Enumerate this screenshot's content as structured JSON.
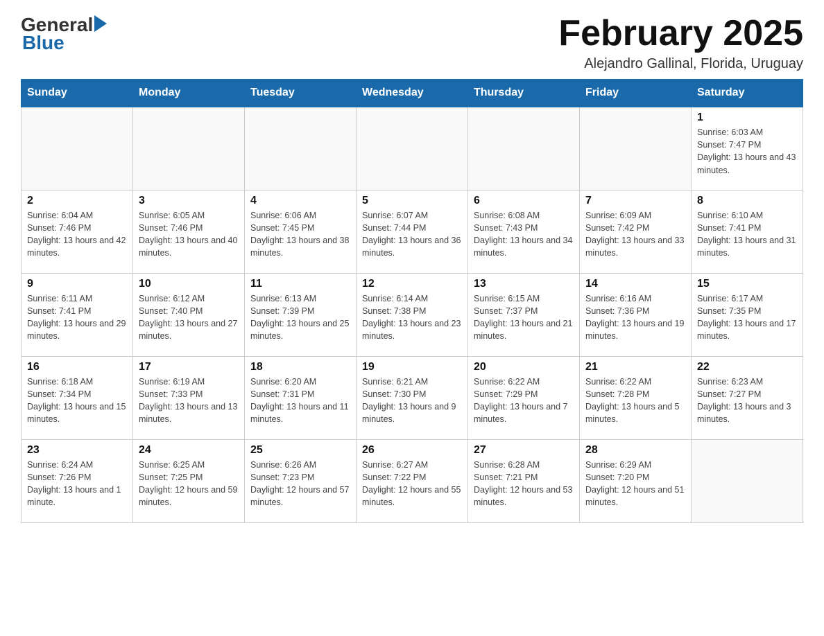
{
  "header": {
    "logo_general": "General",
    "logo_blue": "Blue",
    "month_title": "February 2025",
    "subtitle": "Alejandro Gallinal, Florida, Uruguay"
  },
  "weekdays": [
    "Sunday",
    "Monday",
    "Tuesday",
    "Wednesday",
    "Thursday",
    "Friday",
    "Saturday"
  ],
  "weeks": [
    [
      {
        "day": "",
        "info": ""
      },
      {
        "day": "",
        "info": ""
      },
      {
        "day": "",
        "info": ""
      },
      {
        "day": "",
        "info": ""
      },
      {
        "day": "",
        "info": ""
      },
      {
        "day": "",
        "info": ""
      },
      {
        "day": "1",
        "info": "Sunrise: 6:03 AM\nSunset: 7:47 PM\nDaylight: 13 hours and 43 minutes."
      }
    ],
    [
      {
        "day": "2",
        "info": "Sunrise: 6:04 AM\nSunset: 7:46 PM\nDaylight: 13 hours and 42 minutes."
      },
      {
        "day": "3",
        "info": "Sunrise: 6:05 AM\nSunset: 7:46 PM\nDaylight: 13 hours and 40 minutes."
      },
      {
        "day": "4",
        "info": "Sunrise: 6:06 AM\nSunset: 7:45 PM\nDaylight: 13 hours and 38 minutes."
      },
      {
        "day": "5",
        "info": "Sunrise: 6:07 AM\nSunset: 7:44 PM\nDaylight: 13 hours and 36 minutes."
      },
      {
        "day": "6",
        "info": "Sunrise: 6:08 AM\nSunset: 7:43 PM\nDaylight: 13 hours and 34 minutes."
      },
      {
        "day": "7",
        "info": "Sunrise: 6:09 AM\nSunset: 7:42 PM\nDaylight: 13 hours and 33 minutes."
      },
      {
        "day": "8",
        "info": "Sunrise: 6:10 AM\nSunset: 7:41 PM\nDaylight: 13 hours and 31 minutes."
      }
    ],
    [
      {
        "day": "9",
        "info": "Sunrise: 6:11 AM\nSunset: 7:41 PM\nDaylight: 13 hours and 29 minutes."
      },
      {
        "day": "10",
        "info": "Sunrise: 6:12 AM\nSunset: 7:40 PM\nDaylight: 13 hours and 27 minutes."
      },
      {
        "day": "11",
        "info": "Sunrise: 6:13 AM\nSunset: 7:39 PM\nDaylight: 13 hours and 25 minutes."
      },
      {
        "day": "12",
        "info": "Sunrise: 6:14 AM\nSunset: 7:38 PM\nDaylight: 13 hours and 23 minutes."
      },
      {
        "day": "13",
        "info": "Sunrise: 6:15 AM\nSunset: 7:37 PM\nDaylight: 13 hours and 21 minutes."
      },
      {
        "day": "14",
        "info": "Sunrise: 6:16 AM\nSunset: 7:36 PM\nDaylight: 13 hours and 19 minutes."
      },
      {
        "day": "15",
        "info": "Sunrise: 6:17 AM\nSunset: 7:35 PM\nDaylight: 13 hours and 17 minutes."
      }
    ],
    [
      {
        "day": "16",
        "info": "Sunrise: 6:18 AM\nSunset: 7:34 PM\nDaylight: 13 hours and 15 minutes."
      },
      {
        "day": "17",
        "info": "Sunrise: 6:19 AM\nSunset: 7:33 PM\nDaylight: 13 hours and 13 minutes."
      },
      {
        "day": "18",
        "info": "Sunrise: 6:20 AM\nSunset: 7:31 PM\nDaylight: 13 hours and 11 minutes."
      },
      {
        "day": "19",
        "info": "Sunrise: 6:21 AM\nSunset: 7:30 PM\nDaylight: 13 hours and 9 minutes."
      },
      {
        "day": "20",
        "info": "Sunrise: 6:22 AM\nSunset: 7:29 PM\nDaylight: 13 hours and 7 minutes."
      },
      {
        "day": "21",
        "info": "Sunrise: 6:22 AM\nSunset: 7:28 PM\nDaylight: 13 hours and 5 minutes."
      },
      {
        "day": "22",
        "info": "Sunrise: 6:23 AM\nSunset: 7:27 PM\nDaylight: 13 hours and 3 minutes."
      }
    ],
    [
      {
        "day": "23",
        "info": "Sunrise: 6:24 AM\nSunset: 7:26 PM\nDaylight: 13 hours and 1 minute."
      },
      {
        "day": "24",
        "info": "Sunrise: 6:25 AM\nSunset: 7:25 PM\nDaylight: 12 hours and 59 minutes."
      },
      {
        "day": "25",
        "info": "Sunrise: 6:26 AM\nSunset: 7:23 PM\nDaylight: 12 hours and 57 minutes."
      },
      {
        "day": "26",
        "info": "Sunrise: 6:27 AM\nSunset: 7:22 PM\nDaylight: 12 hours and 55 minutes."
      },
      {
        "day": "27",
        "info": "Sunrise: 6:28 AM\nSunset: 7:21 PM\nDaylight: 12 hours and 53 minutes."
      },
      {
        "day": "28",
        "info": "Sunrise: 6:29 AM\nSunset: 7:20 PM\nDaylight: 12 hours and 51 minutes."
      },
      {
        "day": "",
        "info": ""
      }
    ]
  ]
}
